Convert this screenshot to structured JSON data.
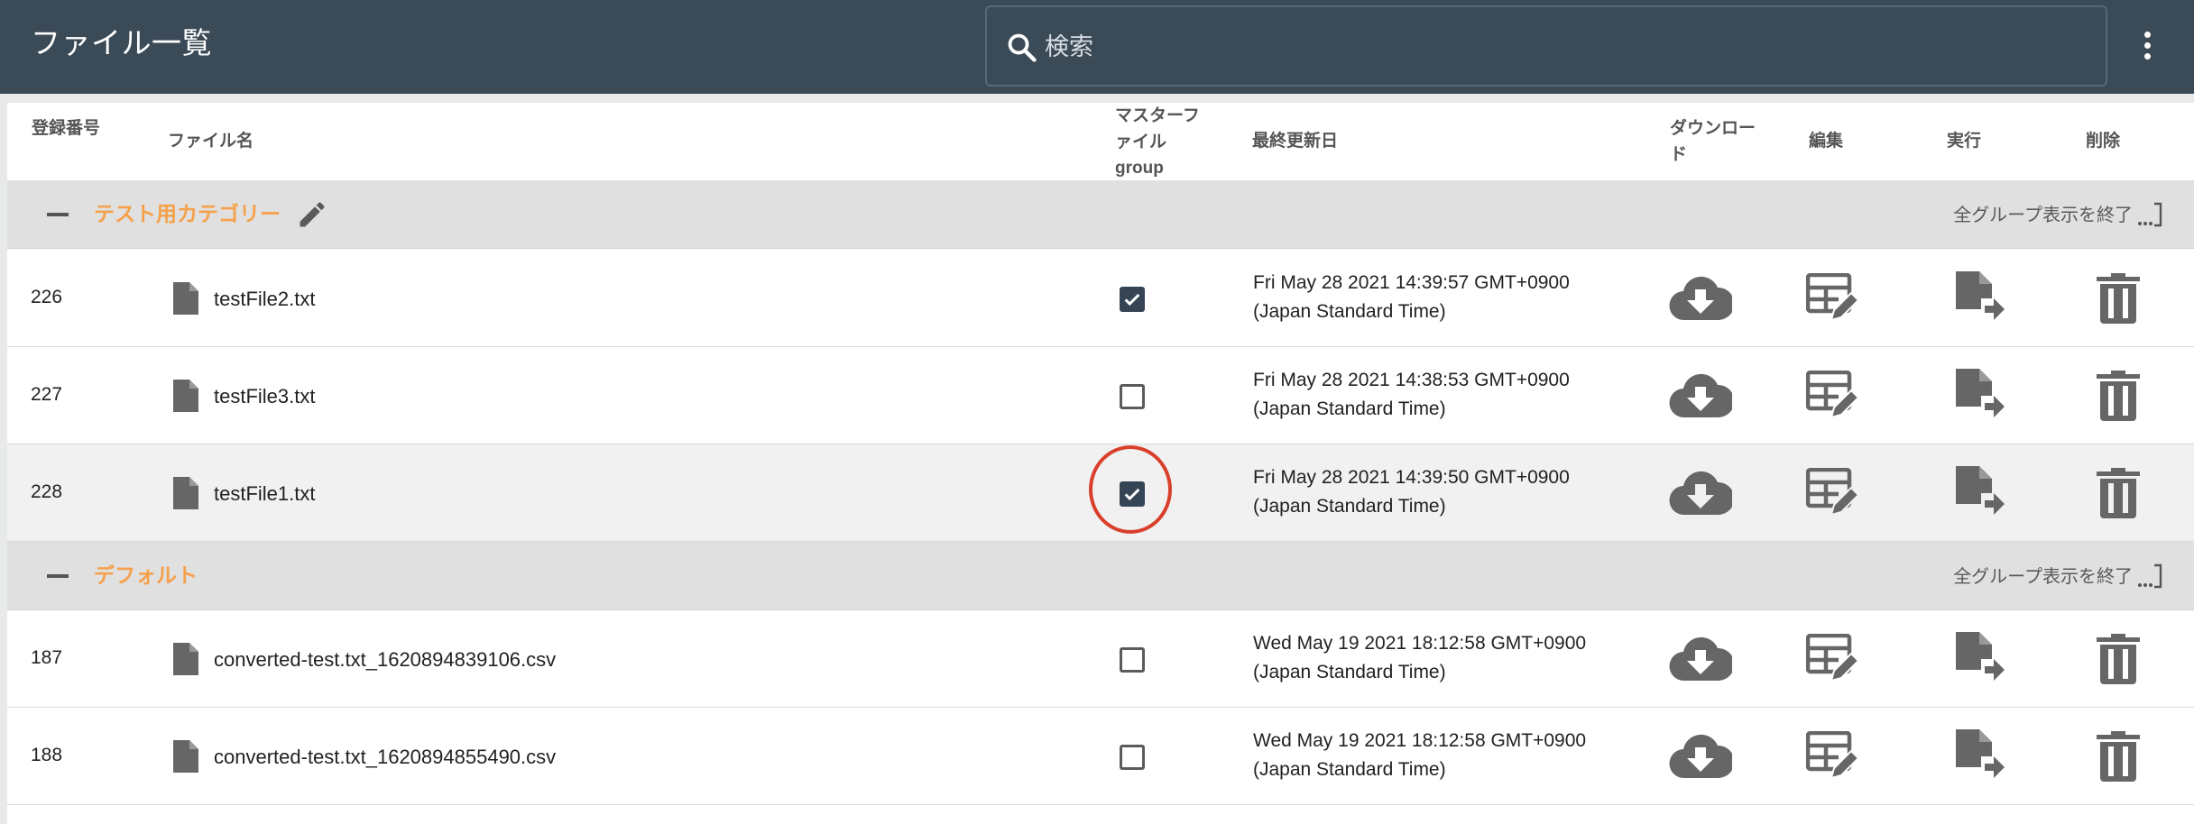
{
  "app": {
    "title": "ファイル一覧",
    "search_placeholder": "検索"
  },
  "columns": {
    "id": "登録番号",
    "name": "ファイル名",
    "master_line1": "マスターフ",
    "master_line2": "ァイル",
    "master_line3": "group",
    "updated": "最終更新日",
    "download_line1": "ダウンロー",
    "download_line2": "ド",
    "edit": "編集",
    "run": "実行",
    "delete": "削除"
  },
  "groups": [
    {
      "name": "テスト用カテゴリー",
      "toggle_label": "全グループ表示を終了",
      "rows": [
        {
          "id": "226",
          "file": "testFile2.txt",
          "master": true,
          "date1": "Fri May 28 2021 14:39:57 GMT+0900",
          "date2": "(Japan Standard Time)"
        },
        {
          "id": "227",
          "file": "testFile3.txt",
          "master": false,
          "date1": "Fri May 28 2021 14:38:53 GMT+0900",
          "date2": "(Japan Standard Time)"
        },
        {
          "id": "228",
          "file": "testFile1.txt",
          "master": true,
          "date1": "Fri May 28 2021 14:39:50 GMT+0900",
          "date2": "(Japan Standard Time)"
        }
      ]
    },
    {
      "name": "デフォルト",
      "toggle_label": "全グループ表示を終了",
      "rows": [
        {
          "id": "187",
          "file": "converted-test.txt_1620894839106.csv",
          "master": false,
          "date1": "Wed May 19 2021 18:12:58 GMT+0900",
          "date2": "(Japan Standard Time)"
        },
        {
          "id": "188",
          "file": "converted-test.txt_1620894855490.csv",
          "master": false,
          "date1": "Wed May 19 2021 18:12:58 GMT+0900",
          "date2": "(Japan Standard Time)"
        }
      ]
    }
  ],
  "colors": {
    "appbar": "#3a4a57",
    "group_name": "#f5a04a",
    "checkbox_checked": "#364555",
    "icon_gray": "#666666",
    "annotation_circle": "#d9402b"
  },
  "icons": {
    "search": "search-icon",
    "menu": "kebab-menu-icon",
    "collapse": "minus-icon",
    "edit_group": "pencil-icon",
    "expand": "expand-icon",
    "file": "file-icon",
    "download": "cloud-download-icon",
    "edit": "table-edit-icon",
    "run": "file-send-icon",
    "delete": "trash-icon"
  }
}
